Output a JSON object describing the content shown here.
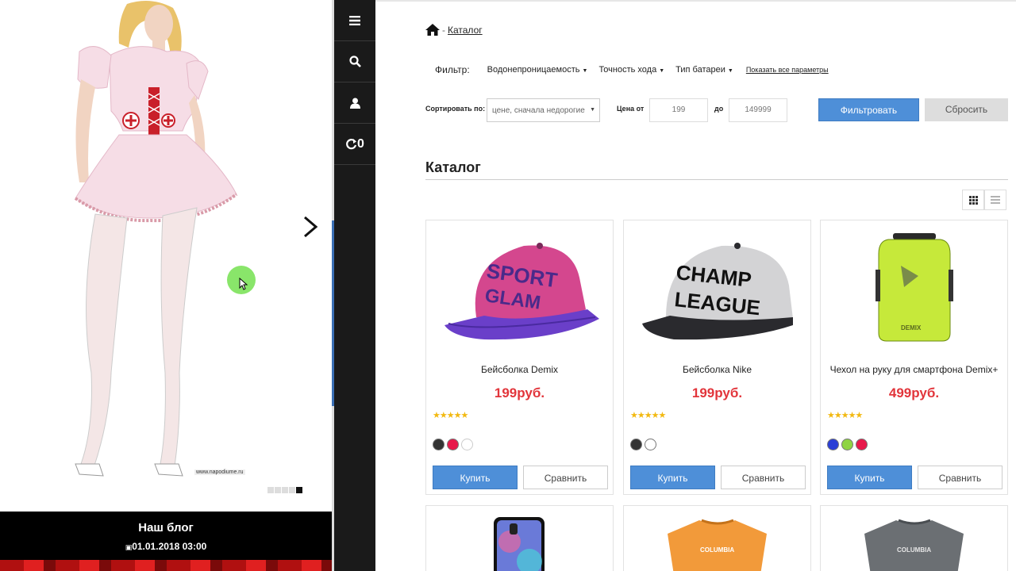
{
  "slider": {
    "watermark": "www.napodiume.ru",
    "dots": 5,
    "active_dot": 5
  },
  "blog": {
    "title": "Наш блог",
    "date": "01.01.2018 03:00"
  },
  "sidebar": {
    "compare_count": "0"
  },
  "breadcrumb": {
    "current": "Каталог"
  },
  "filter": {
    "label": "Фильтр:",
    "items": [
      "Водонепроницаемость",
      "Точность хода",
      "Тип батареи"
    ],
    "show_all": "Показать все параметры"
  },
  "sort": {
    "label": "Сортировать по:",
    "value": "цене, сначала недорогие",
    "price_from_label": "Цена от",
    "price_from": "199",
    "price_to_label": "до",
    "price_to": "149999",
    "filter_button": "Фильтровать",
    "reset_button": "Сбросить"
  },
  "catalog": {
    "title": "Каталог"
  },
  "products": [
    {
      "name": "Бейсболка Demix",
      "price": "199руб.",
      "stars": "★★★★★",
      "colors": [
        "#333333",
        "#e8194b",
        "#ffffff"
      ],
      "buy": "Купить",
      "compare": "Сравнить"
    },
    {
      "name": "Бейсболка Nike",
      "price": "199руб.",
      "stars": "★★★★★",
      "colors": [
        "#333333",
        "#ffffff"
      ],
      "buy": "Купить",
      "compare": "Сравнить"
    },
    {
      "name": "Чехол на руку для смартфона Demix+",
      "price": "499руб.",
      "stars": "★★★★★",
      "colors": [
        "#2b3fd6",
        "#8fd442",
        "#e8194b"
      ],
      "buy": "Купить",
      "compare": "Сравнить"
    }
  ],
  "colors": {
    "accent": "#4e8fd8",
    "price": "#e2353b",
    "sidebar": "#1a1a1a"
  }
}
